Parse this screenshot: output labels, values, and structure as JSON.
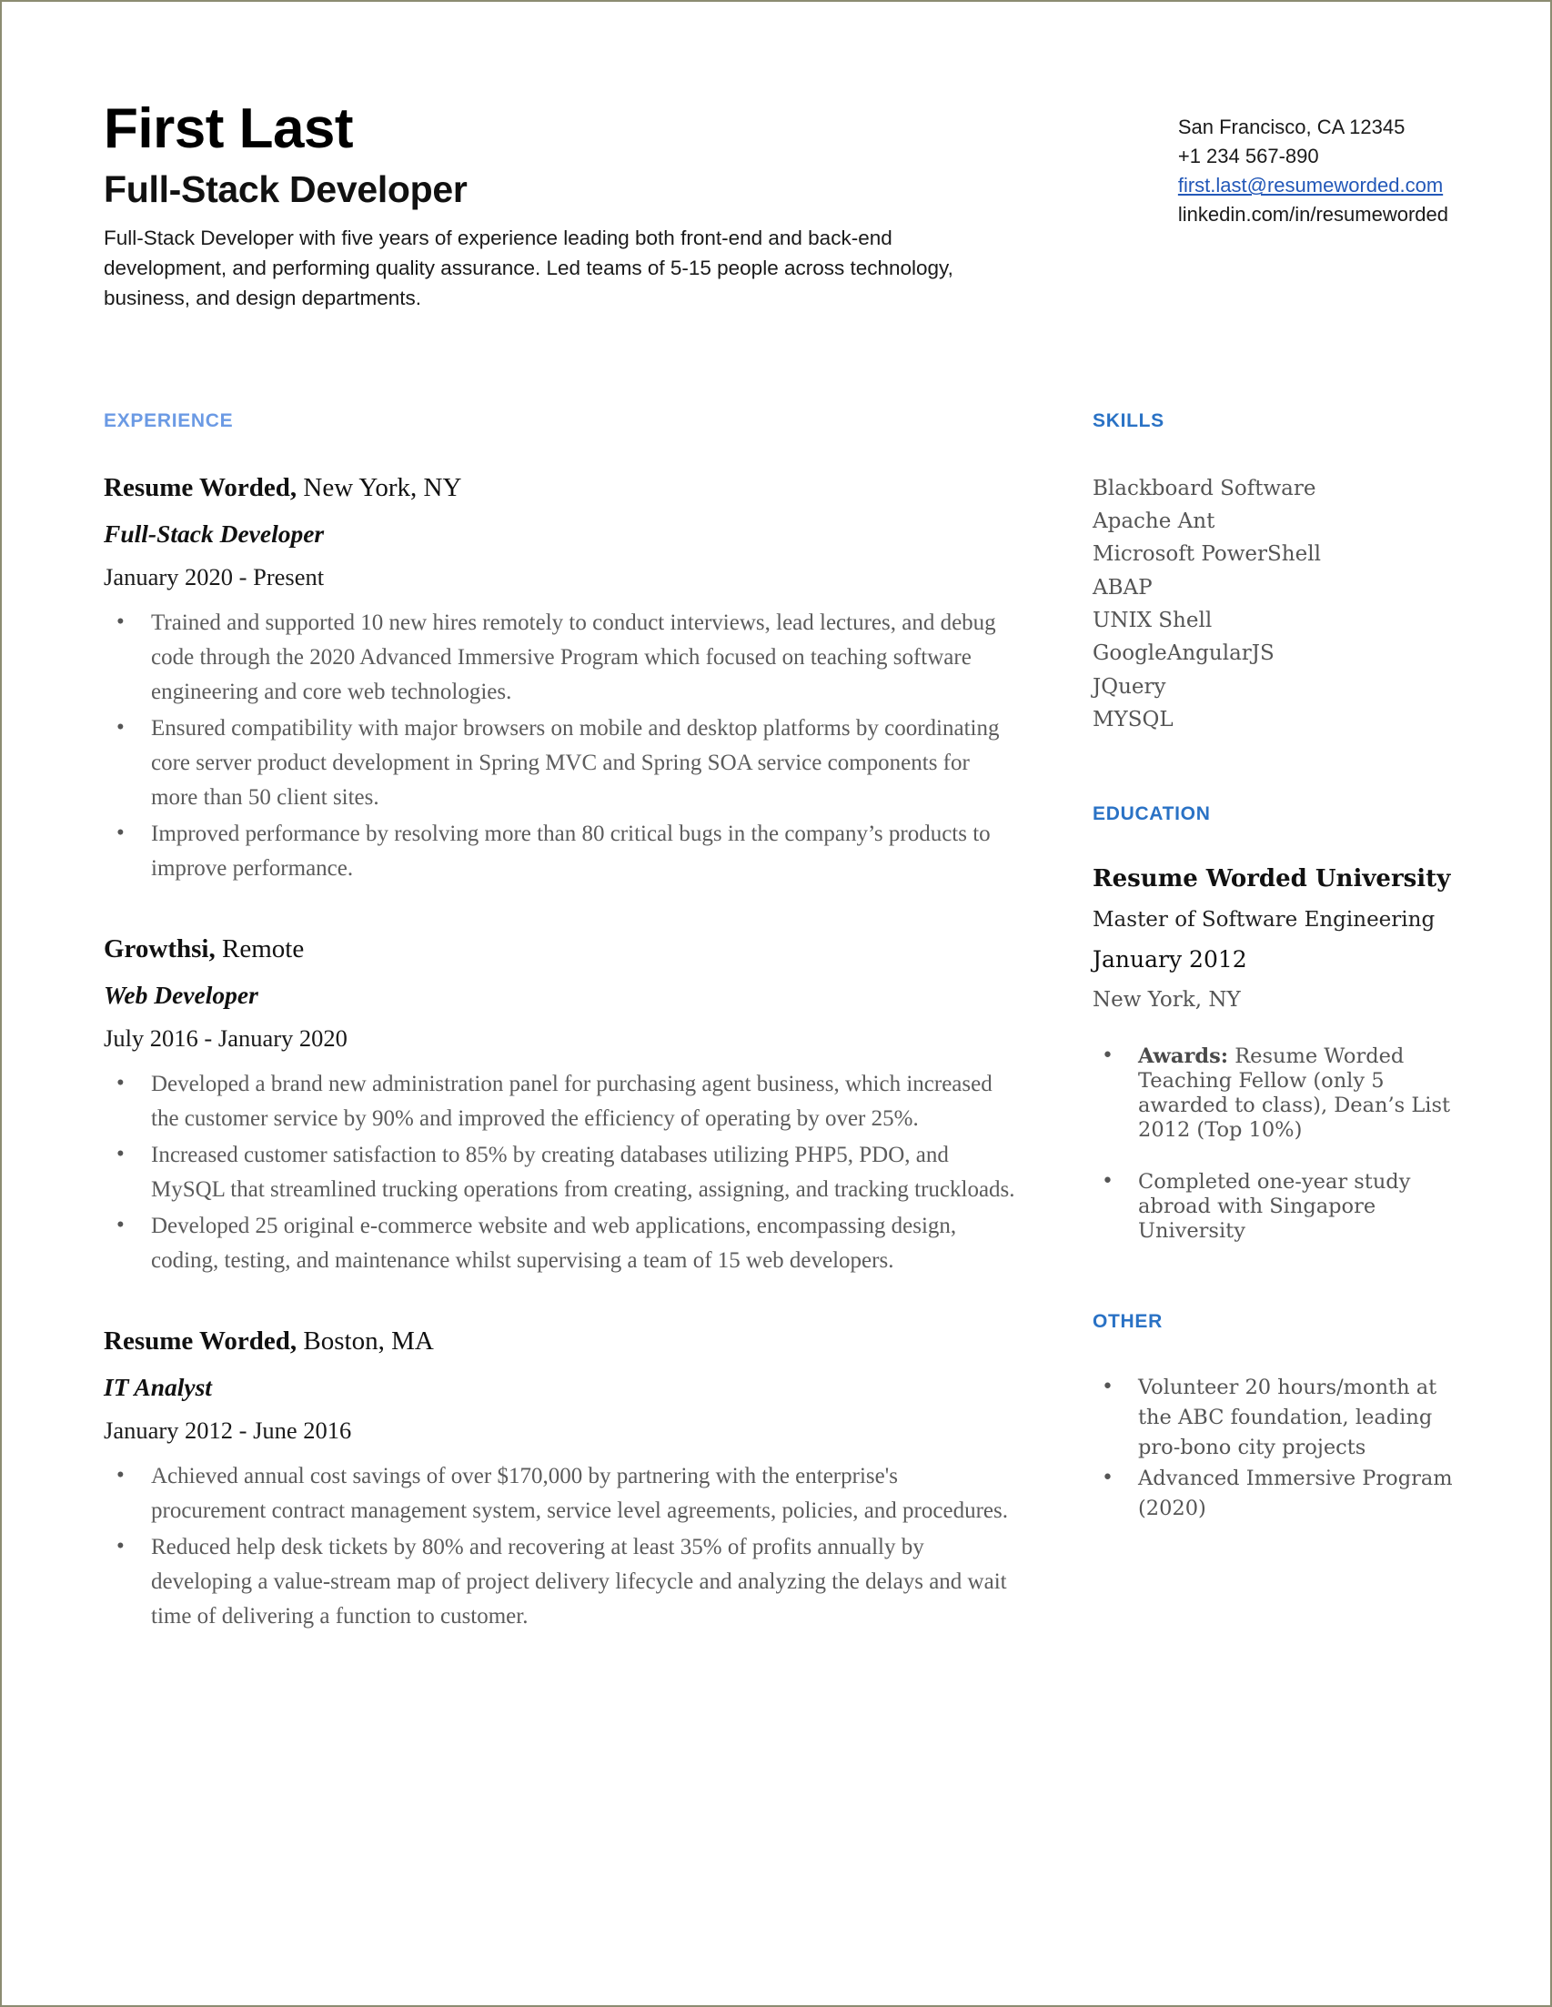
{
  "theme": {
    "accent_light": "#6b9ae4",
    "accent_deep": "#2a72c5",
    "link_color": "#2358b8",
    "body_text": "#5c5c5c",
    "page_border": "#8c8c72"
  },
  "header": {
    "name": "First Last",
    "job_title": "Full-Stack Developer",
    "summary": "Full-Stack Developer with five years of experience leading both front-end and back-end development, and performing quality assurance. Led teams of 5-15 people across technology, business, and design departments.",
    "contact": {
      "location": "San Francisco, CA 12345",
      "phone": "+1 234 567-890",
      "email": "first.last@resumeworded.com",
      "linkedin": "linkedin.com/in/resumeworded"
    }
  },
  "experience": {
    "heading": "EXPERIENCE",
    "jobs": [
      {
        "company": "Resume Worded,",
        "location": " New York, NY",
        "role": "Full-Stack Developer",
        "dates": "January 2020 - Present",
        "bullets": [
          "Trained and supported 10 new hires remotely to conduct interviews, lead lectures, and debug code through the 2020 Advanced Immersive Program which focused on teaching software engineering and core web technologies.",
          "Ensured compatibility with major browsers on mobile and desktop platforms by coordinating core server product development in Spring MVC and Spring SOA service components for more than 50 client sites.",
          "Improved performance by resolving more than 80 critical bugs in the company’s products to improve performance."
        ]
      },
      {
        "company": "Growthsi,",
        "location": " Remote",
        "role": "Web Developer",
        "dates": "July 2016 - January 2020",
        "bullets": [
          "Developed a brand new administration panel for purchasing agent business, which increased the customer service by 90% and improved the efficiency of operating by over 25%.",
          "Increased customer satisfaction to 85% by creating databases utilizing PHP5, PDO, and MySQL that streamlined trucking operations from creating, assigning, and tracking truckloads.",
          "Developed 25 original e-commerce website and web applications, encompassing design, coding, testing, and maintenance whilst supervising a team of 15 web developers."
        ]
      },
      {
        "company": "Resume Worded,",
        "location": " Boston, MA",
        "role": "IT Analyst",
        "dates": "January 2012 - June 2016",
        "bullets": [
          "Achieved annual cost savings of over $170,000 by partnering with the enterprise's procurement contract management system, service level agreements, policies, and procedures.",
          "Reduced help desk tickets by 80% and recovering at least 35% of profits annually by developing a value-stream map of project delivery lifecycle and analyzing the delays and wait time of delivering a function to customer."
        ]
      }
    ]
  },
  "skills": {
    "heading": "SKILLS",
    "items": [
      "Blackboard Software",
      "Apache Ant",
      "Microsoft PowerShell",
      "ABAP",
      "UNIX Shell",
      "GoogleAngularJS",
      "JQuery",
      "MYSQL"
    ]
  },
  "education": {
    "heading": "EDUCATION",
    "school": "Resume Worded University",
    "degree": "Master of Software Engineering",
    "date": "January 2012",
    "location": "New York, NY",
    "bullets": [
      {
        "label": "Awards:",
        "text": " Resume Worded Teaching Fellow (only 5 awarded to class), Dean’s List 2012 (Top 10%)"
      },
      {
        "label": "",
        "text": "Completed one-year study abroad with Singapore University"
      }
    ]
  },
  "other": {
    "heading": "OTHER",
    "items": [
      "Volunteer 20 hours/month at the ABC foundation, leading pro-bono city projects",
      "Advanced Immersive Program (2020)"
    ]
  }
}
